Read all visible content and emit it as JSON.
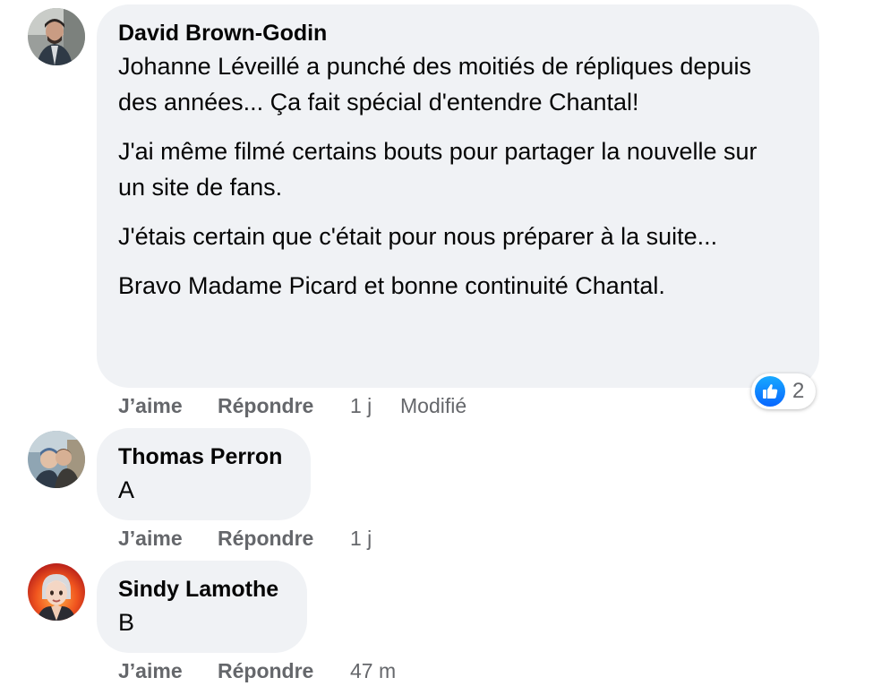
{
  "comments": [
    {
      "author": "David Brown-Godin",
      "paragraphs": [
        "Johanne Léveillé a punché des moitiés de répliques depuis des années... Ça fait spécial d'entendre Chantal!",
        "J'ai même filmé certains bouts pour partager la nouvelle sur un site de fans.",
        "J'étais certain que c'était pour nous préparer à la suite...",
        "Bravo Madame Picard et bonne continuité Chantal."
      ],
      "like_label": "J’aime",
      "reply_label": "Répondre",
      "time": "1 j",
      "edited": "Modifié",
      "reaction_icon": "thumbs-up-icon",
      "reaction_count": "2"
    },
    {
      "author": "Thomas Perron",
      "text": "A",
      "like_label": "J’aime",
      "reply_label": "Répondre",
      "time": "1 j"
    },
    {
      "author": "Sindy Lamothe",
      "text": "B",
      "like_label": "J’aime",
      "reply_label": "Répondre",
      "time": "47 m"
    }
  ],
  "colors": {
    "bubble": "#f0f2f5",
    "meta_text": "#65676b",
    "like_blue": "#0866ff"
  }
}
